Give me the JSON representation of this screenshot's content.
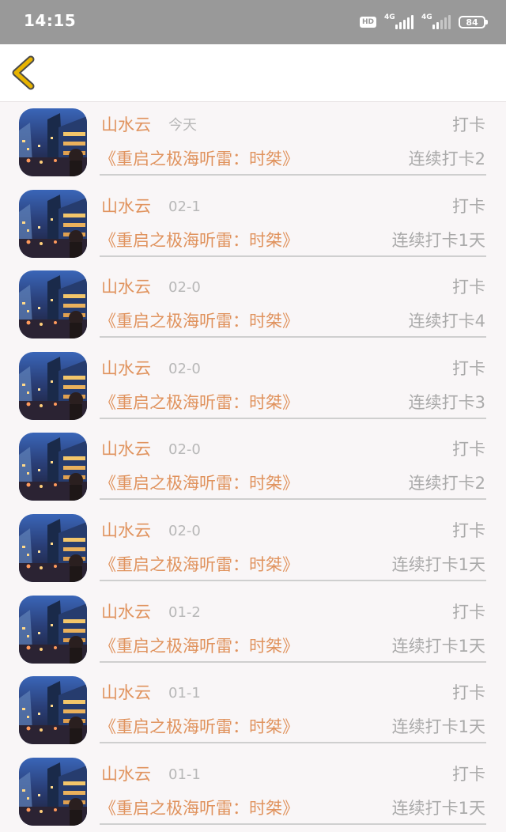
{
  "status_bar": {
    "time": "14:15",
    "hd": "HD",
    "network_1": "4G",
    "network_2": "4G",
    "battery": "84"
  },
  "nav": {
    "back_icon": "chevron-left-icon",
    "back_icon_color": "#e8b400"
  },
  "colors": {
    "accent": "#e0935e",
    "muted": "#aaaaaa"
  },
  "records": [
    {
      "name": "山水云",
      "date": "今天",
      "action": "打卡",
      "book": "《重启之极海听雷：时桀》",
      "streak": "连续打卡2"
    },
    {
      "name": "山水云",
      "date": "02-1",
      "action": "打卡",
      "book": "《重启之极海听雷：时桀》",
      "streak": "连续打卡1天"
    },
    {
      "name": "山水云",
      "date": "02-0",
      "action": "打卡",
      "book": "《重启之极海听雷：时桀》",
      "streak": "连续打卡4"
    },
    {
      "name": "山水云",
      "date": "02-0",
      "action": "打卡",
      "book": "《重启之极海听雷：时桀》",
      "streak": "连续打卡3"
    },
    {
      "name": "山水云",
      "date": "02-0",
      "action": "打卡",
      "book": "《重启之极海听雷：时桀》",
      "streak": "连续打卡2"
    },
    {
      "name": "山水云",
      "date": "02-0",
      "action": "打卡",
      "book": "《重启之极海听雷：时桀》",
      "streak": "连续打卡1天"
    },
    {
      "name": "山水云",
      "date": "01-2",
      "action": "打卡",
      "book": "《重启之极海听雷：时桀》",
      "streak": "连续打卡1天"
    },
    {
      "name": "山水云",
      "date": "01-1",
      "action": "打卡",
      "book": "《重启之极海听雷：时桀》",
      "streak": "连续打卡1天"
    },
    {
      "name": "山水云",
      "date": "01-1",
      "action": "打卡",
      "book": "《重启之极海听雷：时桀》",
      "streak": "连续打卡1天"
    }
  ]
}
